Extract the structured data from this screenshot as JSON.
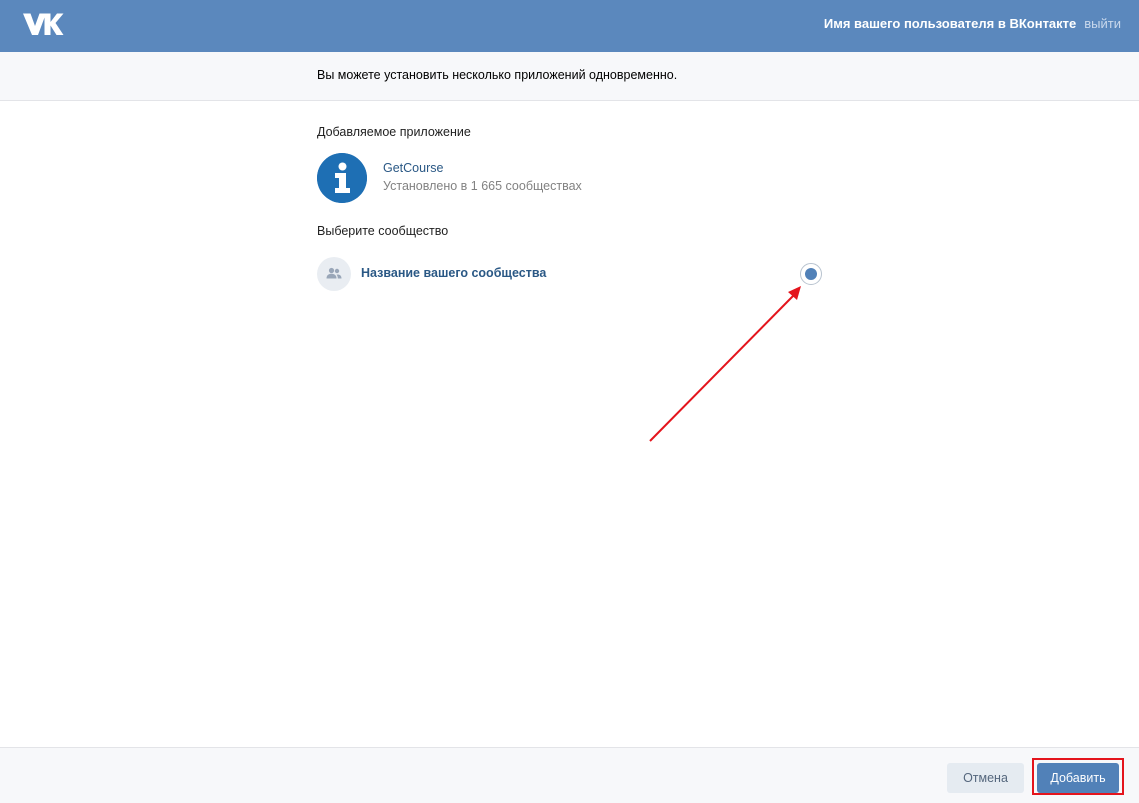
{
  "header": {
    "logo_icon": "vk-logo-icon",
    "username": "Имя вашего пользователя в ВКонтакте",
    "logout_label": "выйти",
    "bg_color": "#5b88bd"
  },
  "info": {
    "text": "Вы можете установить несколько приложений одновременно."
  },
  "app_section": {
    "title": "Добавляемое приложение",
    "app": {
      "icon": "info-icon",
      "name": "GetCourse",
      "installed_text": "Установлено в 1 665 сообществах"
    }
  },
  "community_section": {
    "title": "Выберите сообщество",
    "communities": [
      {
        "icon": "users-icon",
        "name": "Название вашего сообщества",
        "selected": true
      }
    ]
  },
  "footer": {
    "cancel_label": "Отмена",
    "add_label": "Добавить",
    "accent_color": "#5181b8",
    "highlight_color": "#e4141c"
  }
}
